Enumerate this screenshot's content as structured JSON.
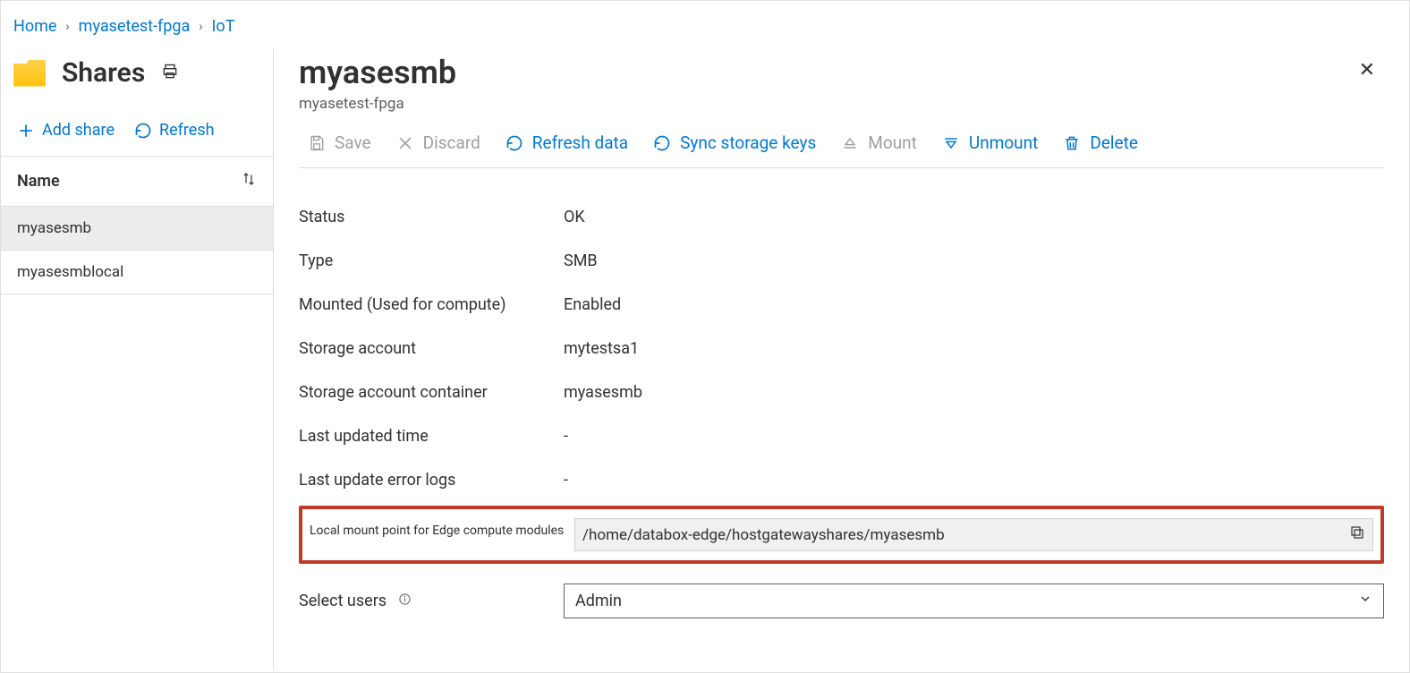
{
  "breadcrumb": {
    "home": "Home",
    "item1": "myasetest-fpga",
    "item2": "IoT"
  },
  "leftPanel": {
    "title": "Shares",
    "addShare": "Add share",
    "refresh": "Refresh",
    "nameHeader": "Name",
    "items": [
      "myasesmb",
      "myasesmblocal"
    ]
  },
  "rightPanel": {
    "title": "myasesmb",
    "subtitle": "myasetest-fpga",
    "toolbar": {
      "save": "Save",
      "discard": "Discard",
      "refreshData": "Refresh data",
      "syncKeys": "Sync storage keys",
      "mount": "Mount",
      "unmount": "Unmount",
      "delete": "Delete"
    },
    "props": {
      "statusLabel": "Status",
      "statusValue": "OK",
      "typeLabel": "Type",
      "typeValue": "SMB",
      "mountedLabel": "Mounted (Used for compute)",
      "mountedValue": "Enabled",
      "storageAccountLabel": "Storage account",
      "storageAccountValue": "mytestsa1",
      "containerLabel": "Storage account container",
      "containerValue": "myasesmb",
      "lastUpdatedLabel": "Last updated time",
      "lastUpdatedValue": "-",
      "errorLogsLabel": "Last update error logs",
      "errorLogsValue": "-",
      "mountPointLabel": "Local mount point for Edge compute modules",
      "mountPointValue": "/home/databox-edge/hostgatewayshares/myasesmb",
      "selectUsersLabel": "Select users",
      "selectUsersValue": "Admin"
    }
  }
}
